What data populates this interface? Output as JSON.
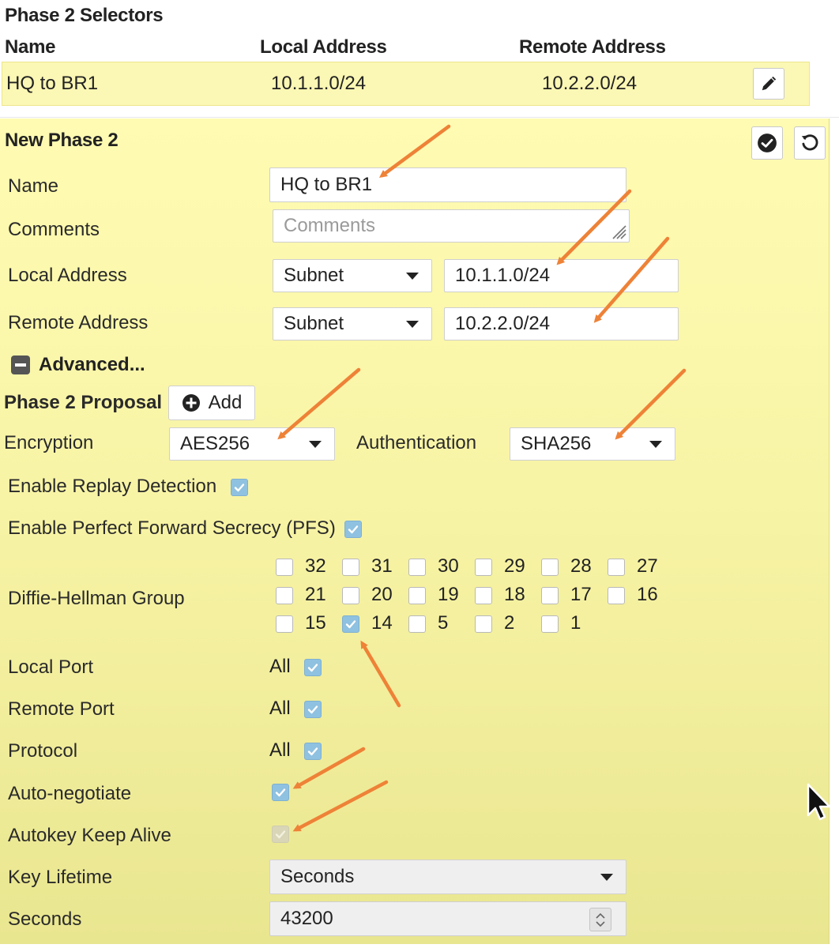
{
  "selectors": {
    "title": "Phase 2 Selectors",
    "headers": {
      "name": "Name",
      "local": "Local Address",
      "remote": "Remote Address"
    },
    "row": {
      "name": "HQ to BR1",
      "local": "10.1.1.0/24",
      "remote": "10.2.2.0/24"
    }
  },
  "phase2": {
    "title": "New Phase 2",
    "name_label": "Name",
    "name_value": "HQ to BR1",
    "comments_label": "Comments",
    "comments_placeholder": "Comments",
    "local_label": "Local Address",
    "local_type": "Subnet",
    "local_value": "10.1.1.0/24",
    "remote_label": "Remote Address",
    "remote_type": "Subnet",
    "remote_value": "10.2.2.0/24",
    "advanced_label": "Advanced...",
    "proposal_label": "Phase 2 Proposal",
    "add_label": "Add",
    "encryption_label": "Encryption",
    "encryption_value": "AES256",
    "authentication_label": "Authentication",
    "authentication_value": "SHA256",
    "replay_label": "Enable Replay Detection",
    "replay_checked": true,
    "pfs_label": "Enable Perfect Forward Secrecy (PFS)",
    "pfs_checked": true,
    "dh_label": "Diffie-Hellman Group",
    "dh_groups": [
      {
        "num": "32",
        "checked": false
      },
      {
        "num": "31",
        "checked": false
      },
      {
        "num": "30",
        "checked": false
      },
      {
        "num": "29",
        "checked": false
      },
      {
        "num": "28",
        "checked": false
      },
      {
        "num": "27",
        "checked": false
      },
      {
        "num": "21",
        "checked": false
      },
      {
        "num": "20",
        "checked": false
      },
      {
        "num": "19",
        "checked": false
      },
      {
        "num": "18",
        "checked": false
      },
      {
        "num": "17",
        "checked": false
      },
      {
        "num": "16",
        "checked": false
      },
      {
        "num": "15",
        "checked": false
      },
      {
        "num": "14",
        "checked": true
      },
      {
        "num": "5",
        "checked": false
      },
      {
        "num": "2",
        "checked": false
      },
      {
        "num": "1",
        "checked": false
      }
    ],
    "local_port_label": "Local Port",
    "local_port_value": "All",
    "remote_port_label": "Remote Port",
    "remote_port_value": "All",
    "protocol_label": "Protocol",
    "protocol_value": "All",
    "autoneg_label": "Auto-negotiate",
    "autoneg_checked": true,
    "keepalive_label": "Autokey Keep Alive",
    "keepalive_checked": true,
    "keepalive_disabled": true,
    "key_lifetime_label": "Key Lifetime",
    "key_lifetime_value": "Seconds",
    "seconds_label": "Seconds",
    "seconds_value": "43200"
  },
  "colors": {
    "panel_bg": "#fffbb2",
    "checkbox_on": "#8fc1e0",
    "annotation_arrow": "#ee8237"
  }
}
